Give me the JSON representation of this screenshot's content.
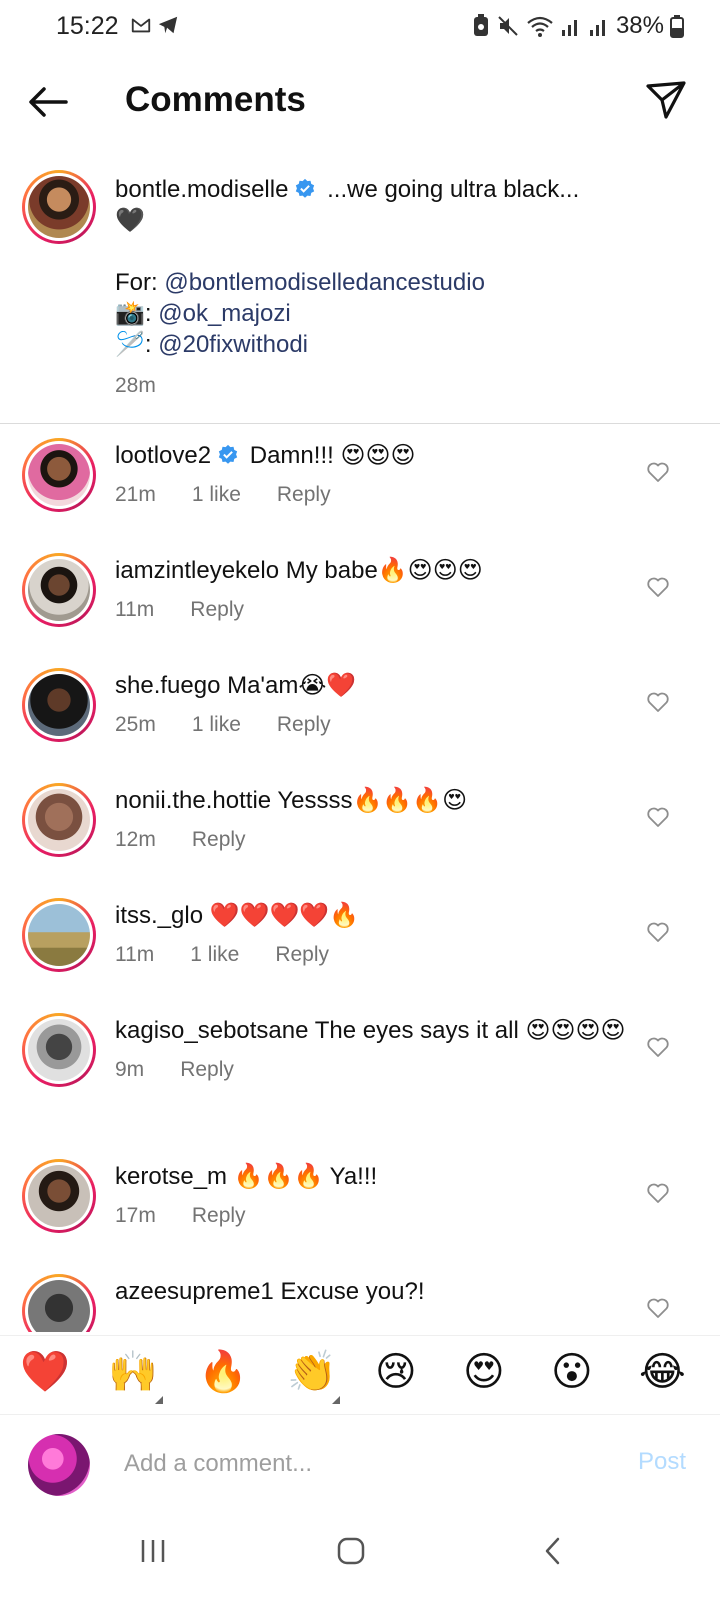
{
  "status_bar": {
    "time": "15:22",
    "battery": "38%",
    "left_icons": [
      "gmail-icon",
      "telegram-icon"
    ],
    "right_icons": [
      "battery-saver-icon",
      "mute-icon",
      "wifi-icon",
      "signal-icon",
      "signal-icon",
      "battery-icon"
    ]
  },
  "header": {
    "title": "Comments"
  },
  "caption": {
    "username": "bontle.modiselle",
    "text": "...we going ultra black...",
    "heart": "🖤",
    "for_label": "For: ",
    "for_link": "@bontlemodiselledancestudio",
    "camera_emoji": "📸",
    "camera_link": "@ok_majozi",
    "needle_emoji": "🪡",
    "needle_link": "@20fixwithodi",
    "colon": ": ",
    "time": "28m"
  },
  "comments": [
    {
      "username": "lootlove2",
      "verified": true,
      "text": "Damn!!! 😍😍😍",
      "time": "21m",
      "likes": "1 like",
      "reply": "Reply"
    },
    {
      "username": "iamzintleyekelo",
      "verified": false,
      "text": "My babe🔥😍😍😍",
      "time": "11m",
      "likes": "",
      "reply": "Reply"
    },
    {
      "username": "she.fuego",
      "verified": false,
      "text": "Ma'am😭❤️",
      "time": "25m",
      "likes": "1 like",
      "reply": "Reply"
    },
    {
      "username": "nonii.the.hottie",
      "verified": false,
      "text": "Yessss🔥🔥🔥😍",
      "time": "12m",
      "likes": "",
      "reply": "Reply"
    },
    {
      "username": "itss._glo",
      "verified": false,
      "text": "❤️❤️❤️❤️🔥",
      "time": "11m",
      "likes": "1 like",
      "reply": "Reply"
    },
    {
      "username": "kagiso_sebotsane",
      "verified": false,
      "text": "The eyes says it all 😍😍😍😍",
      "time": "9m",
      "likes": "",
      "reply": "Reply"
    },
    {
      "username": "kerotse_m",
      "verified": false,
      "text": "🔥🔥🔥 Ya!!!",
      "time": "17m",
      "likes": "",
      "reply": "Reply"
    },
    {
      "username": "azeesupreme1",
      "verified": false,
      "text": "Excuse you?!",
      "time": "",
      "likes": "",
      "reply": ""
    }
  ],
  "emoji_bar": [
    "❤️",
    "🙌",
    "🔥",
    "👏",
    "😢",
    "😍",
    "😮",
    "😂"
  ],
  "composer": {
    "placeholder": "Add a comment...",
    "post_label": "Post"
  },
  "colors": {
    "link": "#2b3a67",
    "verified": "#3897f0",
    "post_disabled": "#b3dbff",
    "meta_grey": "#737373"
  }
}
